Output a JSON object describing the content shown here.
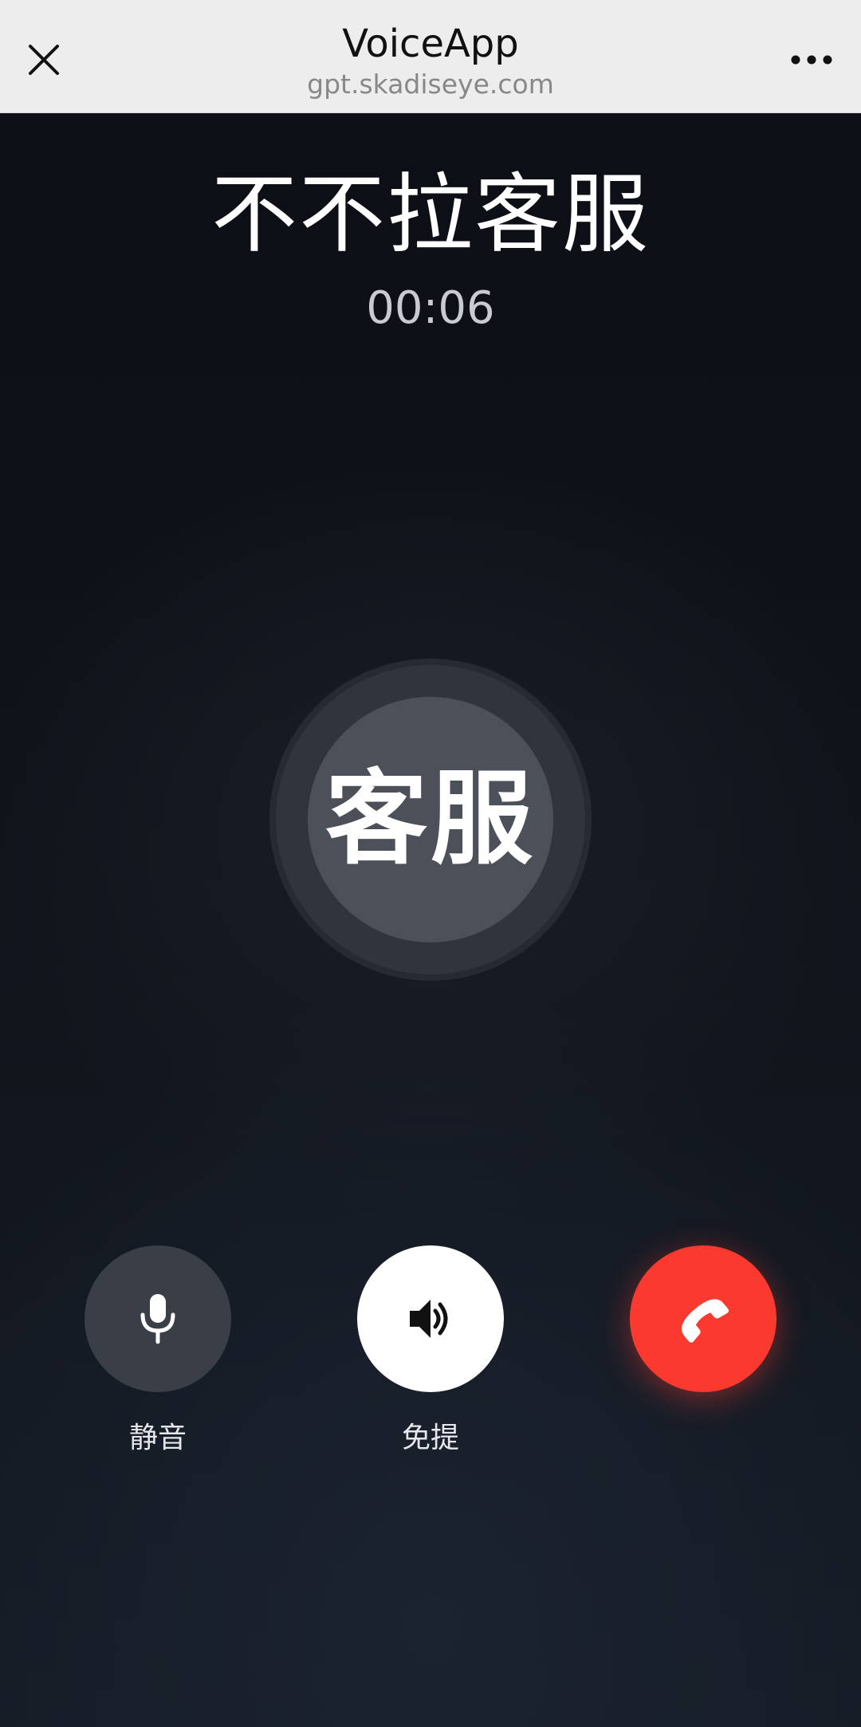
{
  "topbar": {
    "title": "VoiceApp",
    "subtitle": "gpt.skadiseye.com",
    "close_icon": "close-icon",
    "more_icon": "more-horizontal-icon"
  },
  "call": {
    "contact_name": "不不拉客服",
    "timer": "00:06",
    "avatar_text": "客服"
  },
  "controls": {
    "mute": {
      "label": "静音",
      "icon": "microphone-icon"
    },
    "speaker": {
      "label": "免提",
      "icon": "speaker-icon"
    },
    "hangup": {
      "icon": "hang-up-icon",
      "color": "#fa3a2e"
    }
  },
  "colors": {
    "topbar_bg": "#ededed",
    "screen_bg": "#0c0f15",
    "hangup_red": "#fa3a2e"
  }
}
